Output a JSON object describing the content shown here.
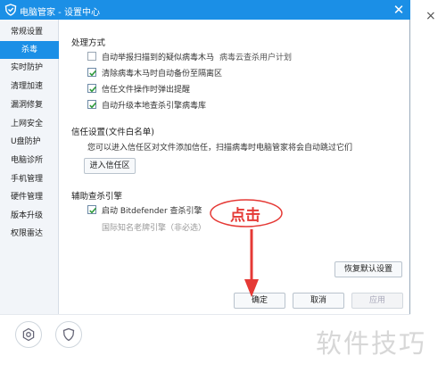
{
  "window": {
    "title": "电脑管家 - 设置中心",
    "close_glyph": "✕"
  },
  "sidebar": {
    "items": [
      {
        "label": "常规设置"
      },
      {
        "label": "杀毒",
        "active": true
      },
      {
        "label": "实时防护"
      },
      {
        "label": "清理加速"
      },
      {
        "label": "漏洞修复"
      },
      {
        "label": "上网安全"
      },
      {
        "label": "U盘防护"
      },
      {
        "label": "电脑诊所"
      },
      {
        "label": "手机管理"
      },
      {
        "label": "硬件管理"
      },
      {
        "label": "版本升级"
      },
      {
        "label": "权限雷达"
      }
    ]
  },
  "sections": {
    "process": {
      "title": "处理方式",
      "options": [
        {
          "label": "自动举报扫描到的疑似病毒木马",
          "extra": "病毒云查杀用户计划",
          "checked": false
        },
        {
          "label": "清除病毒木马时自动备份至隔离区",
          "checked": true
        },
        {
          "label": "信任文件操作时弹出提醒",
          "checked": true
        },
        {
          "label": "自动升级本地查杀引擎病毒库",
          "checked": true
        }
      ]
    },
    "trust": {
      "title": "信任设置(文件白名单)",
      "description": "您可以进入信任区对文件添加信任，扫描病毒时电脑管家将会自动跳过它们",
      "button": "进入信任区"
    },
    "engine": {
      "title": "辅助查杀引擎",
      "option": {
        "label": "启动 Bitdefender 查杀引擎",
        "checked": true
      },
      "hint": "国际知名老牌引擎（非必选）"
    }
  },
  "buttons": {
    "restore": "恢复默认设置",
    "ok": "确定",
    "cancel": "取消",
    "apply": "应用"
  },
  "annotation": {
    "text": "点击",
    "color": "#e53935"
  },
  "bottom": {
    "icons": [
      "gear-icon",
      "shield-icon"
    ]
  },
  "right_strip": {
    "close_glyph": "×"
  },
  "watermark": "软件技巧",
  "colors": {
    "accent": "#1b8fe6",
    "checkmark": "#2e9a3a",
    "annotation": "#e53935"
  }
}
